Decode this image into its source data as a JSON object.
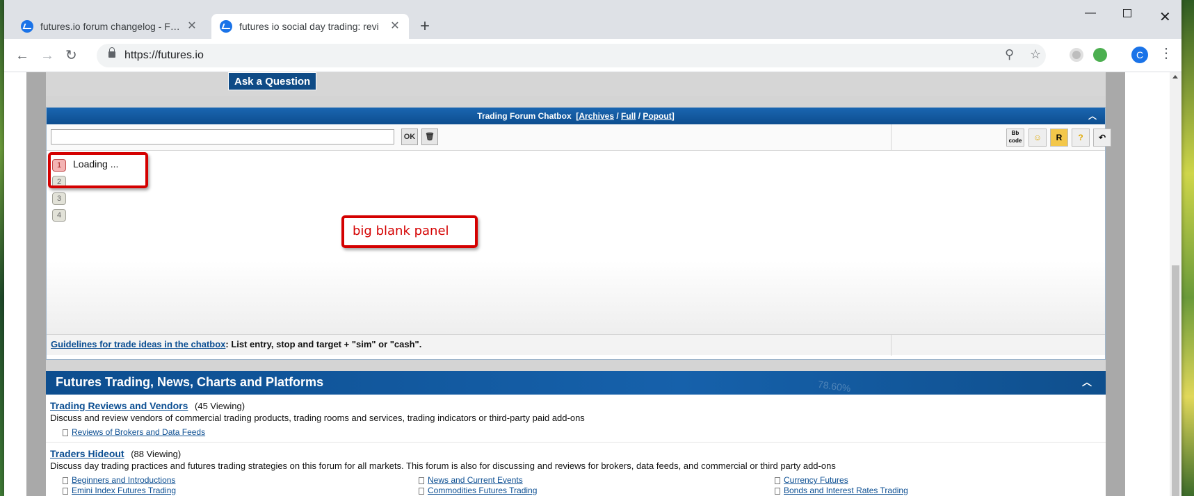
{
  "browser": {
    "tabs": [
      {
        "title": "futures.io forum changelog - Fee",
        "active": false
      },
      {
        "title": "futures io social day trading: revi",
        "active": true
      }
    ],
    "url": "https://futures.io",
    "profile_initial": "C"
  },
  "page": {
    "ask_button": "Ask a Question",
    "chatbox": {
      "title": "Trading Forum Chatbox",
      "links": [
        "Archives",
        "Full",
        "Popout"
      ],
      "ok_button": "OK",
      "message_numbers": [
        "1",
        "2",
        "3",
        "4"
      ],
      "loading_text": "Loading ...",
      "tools": [
        "Bb code",
        "smiley",
        "R",
        "?",
        "undo"
      ],
      "footer_link": "Guidelines for trade ideas in the chatbox",
      "footer_text": ": List entry, stop and target + \"sim\" or \"cash\"."
    },
    "annotation": {
      "label": "big blank panel"
    },
    "forum_section": {
      "title": "Futures Trading, News, Charts and Platforms",
      "background_text": "78.60%",
      "forums": [
        {
          "name": "Trading Reviews and Vendors",
          "viewing": "(45 Viewing)",
          "description": "Discuss and review vendors of commercial trading products, trading rooms and services, trading indicators or third-party paid add-ons",
          "subforums": [
            "Reviews of Brokers and Data Feeds"
          ]
        },
        {
          "name": "Traders Hideout",
          "viewing": "(88 Viewing)",
          "description": "Discuss day trading practices and futures trading strategies on this forum for all markets. This forum is also for discussing and reviews for brokers, data feeds, and commercial or third party add-ons",
          "subforums": [
            "Beginners and Introductions",
            "News and Current Events",
            "Currency Futures",
            "Emini Index Futures Trading",
            "Commodities Futures Trading",
            "Bonds and Interest Rates Trading"
          ]
        }
      ]
    }
  },
  "colors": {
    "site_blue": "#0d4e8f",
    "link_blue": "#0b4e92",
    "annotation_red": "#d40000"
  }
}
